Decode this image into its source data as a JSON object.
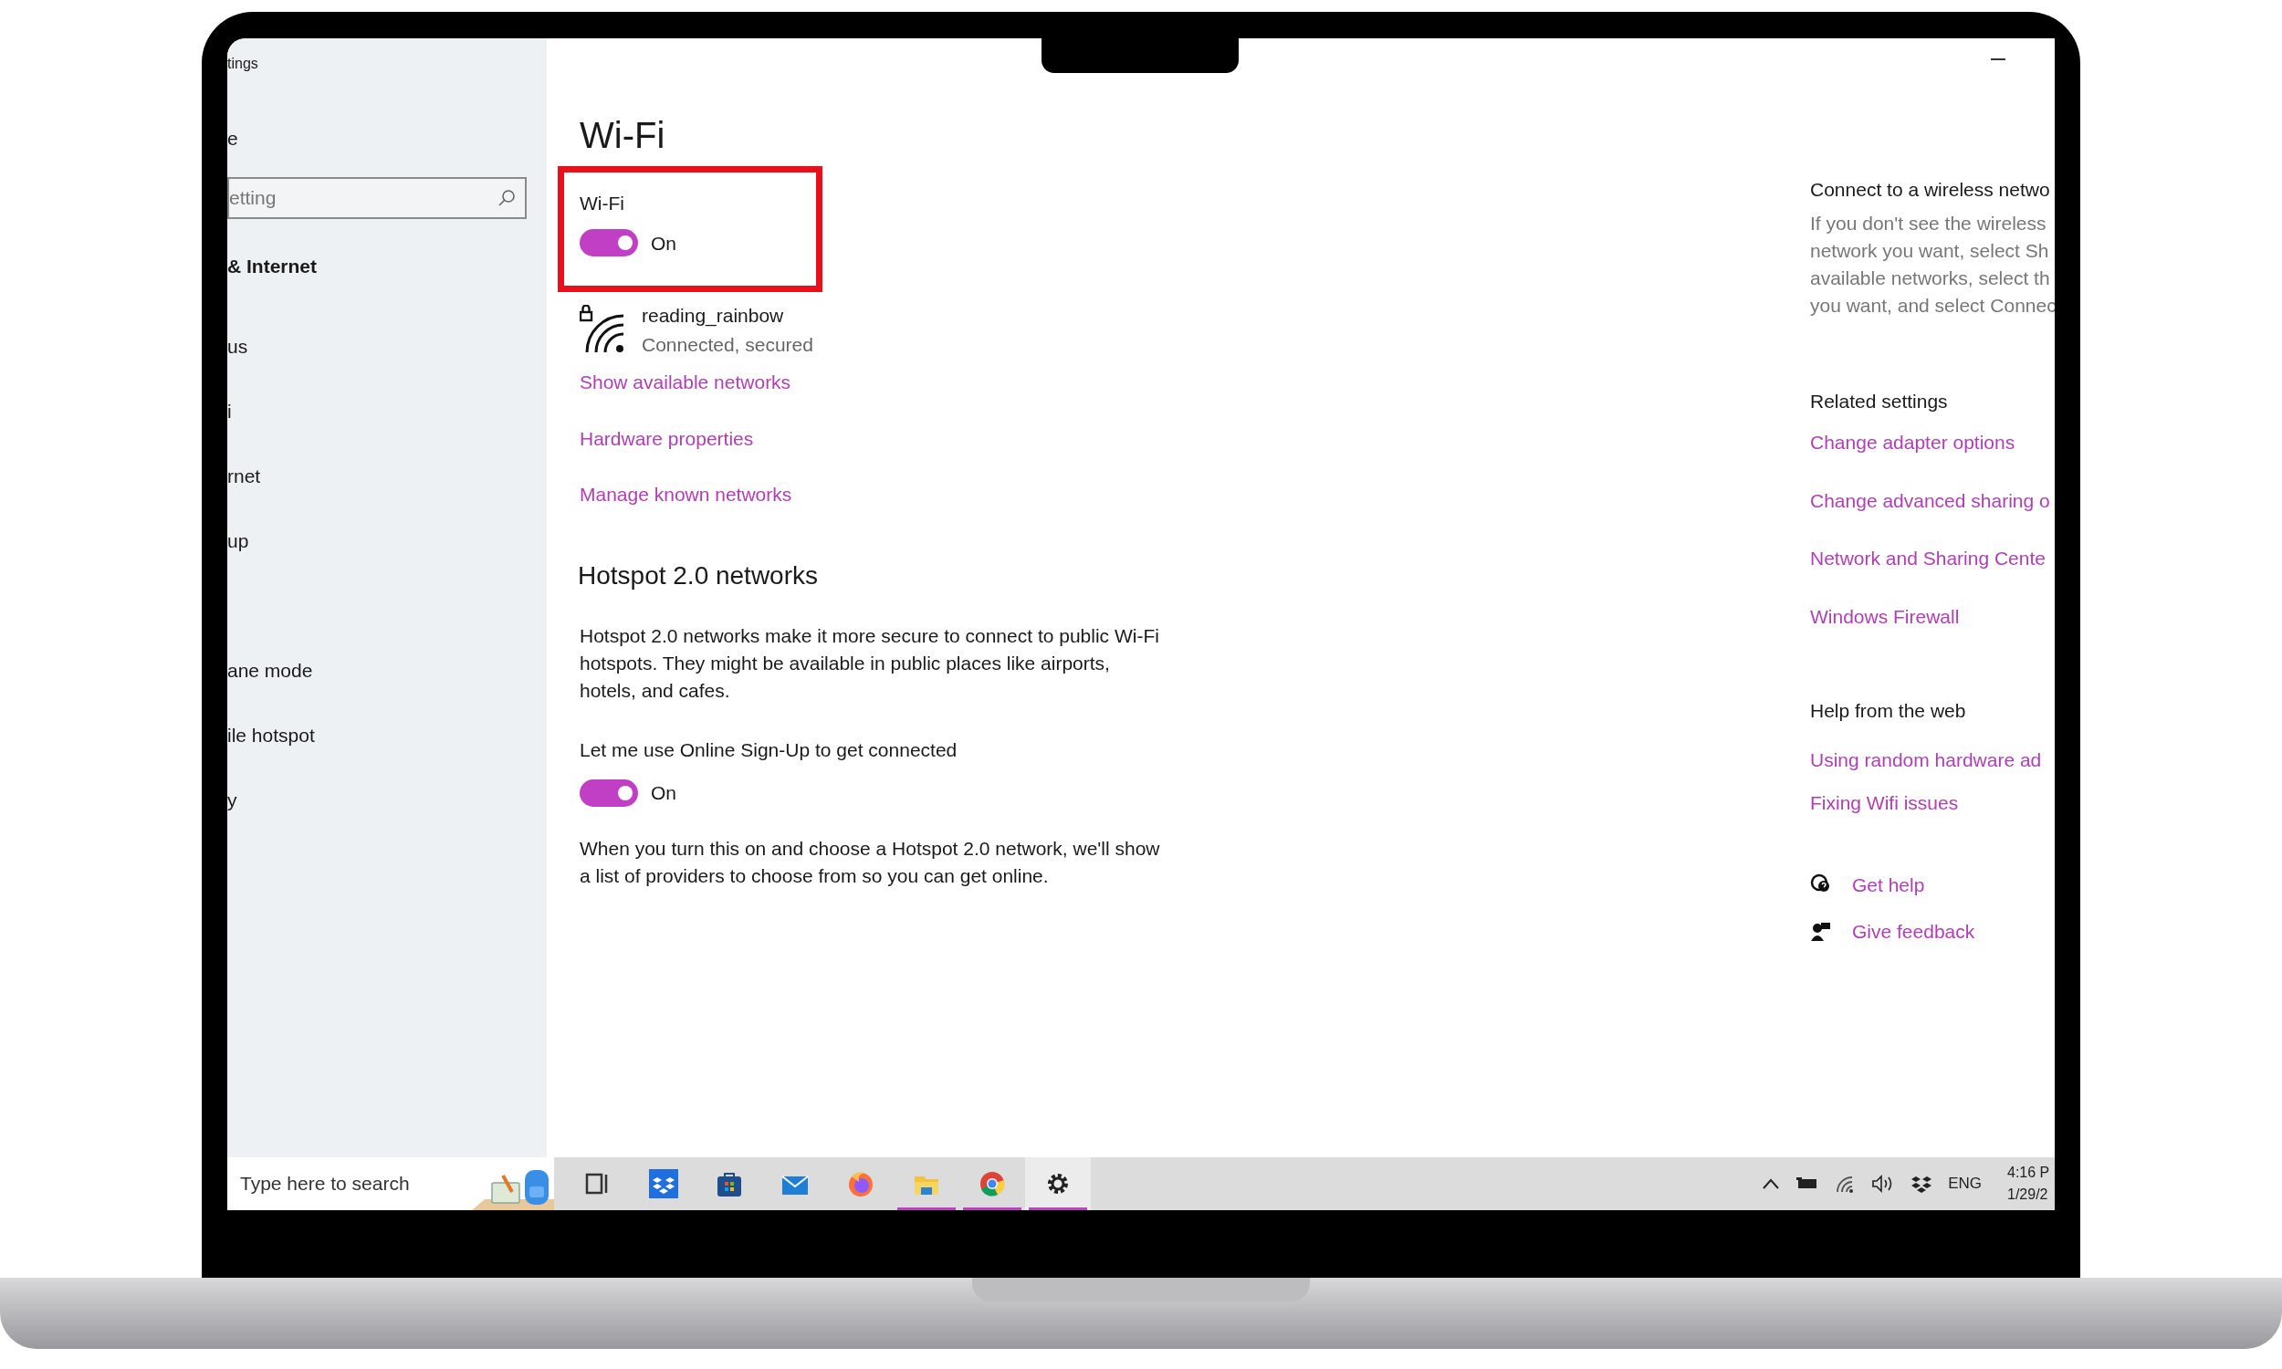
{
  "window": {
    "title": "tings"
  },
  "sidebar": {
    "home": "e",
    "search": {
      "placeholder": "etting"
    },
    "section": "& Internet",
    "items": [
      {
        "label": "us"
      },
      {
        "label": "i"
      },
      {
        "label": "rnet"
      },
      {
        "label": "up"
      },
      {
        "label": "ane mode"
      },
      {
        "label": "ile hotspot"
      },
      {
        "label": "y"
      }
    ]
  },
  "main": {
    "title": "Wi-Fi",
    "wifi_toggle": {
      "label": "Wi-Fi",
      "on": true,
      "state": "On"
    },
    "network": {
      "name": "reading_rainbow",
      "status": "Connected, secured"
    },
    "links": [
      "Show available networks",
      "Hardware properties",
      "Manage known networks"
    ],
    "hotspot": {
      "heading": "Hotspot 2.0 networks",
      "description": "Hotspot 2.0 networks make it more secure to connect to public Wi-Fi hotspots. They might be available in public places like airports, hotels, and cafes.",
      "toggle_label": "Let me use Online Sign-Up to get connected",
      "toggle": {
        "on": true,
        "state": "On"
      },
      "note": "When you turn this on and choose a Hotspot 2.0 network, we'll show a list of providers to choose from so you can get online."
    }
  },
  "right_panel": {
    "connect_heading": "Connect to a wireless netwo",
    "connect_text": [
      "If you don't see the wireless",
      "network you want, select Sh",
      "available networks, select th",
      "you want, and select Connec"
    ],
    "related_heading": "Related settings",
    "related_links": [
      "Change adapter options",
      "Change advanced sharing o",
      "Network and Sharing Cente",
      "Windows Firewall"
    ],
    "help_heading": "Help from the web",
    "help_links": [
      "Using random hardware ad",
      "Fixing Wifi issues"
    ],
    "actions": [
      {
        "kind": "help",
        "label": "Get help"
      },
      {
        "kind": "feedback",
        "label": "Give feedback"
      }
    ]
  },
  "taskbar": {
    "search": {
      "placeholder": "Type here to search"
    },
    "apps": [
      {
        "kind": "task-view",
        "running": false
      },
      {
        "kind": "dropbox",
        "running": false
      },
      {
        "kind": "store",
        "running": false
      },
      {
        "kind": "mail",
        "running": false
      },
      {
        "kind": "firefox",
        "running": false
      },
      {
        "kind": "explorer",
        "running": true
      },
      {
        "kind": "chrome",
        "running": true
      },
      {
        "kind": "settings",
        "running": true
      }
    ],
    "language": "ENG",
    "time": "4:16 P",
    "date": "1/29/2"
  }
}
